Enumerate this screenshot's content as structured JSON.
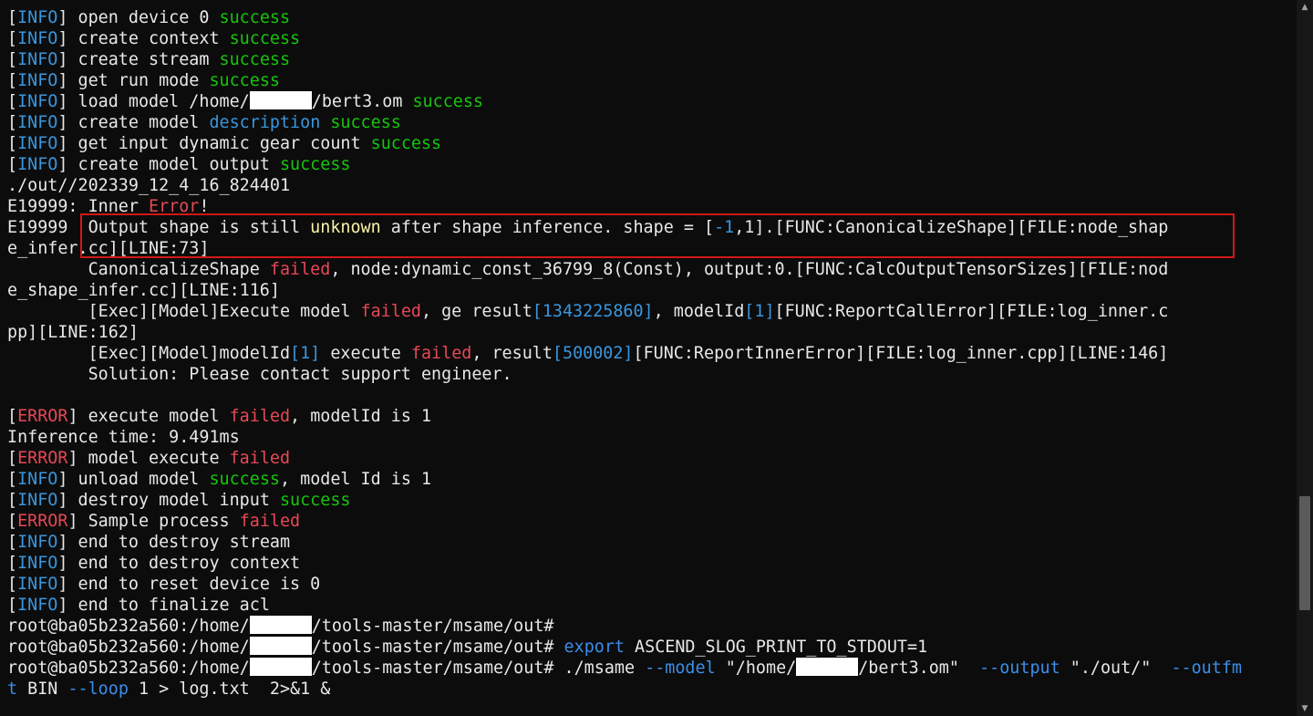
{
  "terminal": {
    "colors": {
      "background": "#0c0c0c",
      "text": "#e8e8e8",
      "info_tag": "#3a96dd",
      "success": "#16c60c",
      "error": "#e74856",
      "highlight_border": "#d01818"
    },
    "lines": [
      [
        {
          "t": "["
        },
        {
          "t": "INFO",
          "c": "info"
        },
        {
          "t": "] open device 0 "
        },
        {
          "t": "success",
          "c": "success"
        }
      ],
      [
        {
          "t": "["
        },
        {
          "t": "INFO",
          "c": "info"
        },
        {
          "t": "] create context "
        },
        {
          "t": "success",
          "c": "success"
        }
      ],
      [
        {
          "t": "["
        },
        {
          "t": "INFO",
          "c": "info"
        },
        {
          "t": "] create stream "
        },
        {
          "t": "success",
          "c": "success"
        }
      ],
      [
        {
          "t": "["
        },
        {
          "t": "INFO",
          "c": "info"
        },
        {
          "t": "] get run mode "
        },
        {
          "t": "success",
          "c": "success"
        }
      ],
      [
        {
          "t": "["
        },
        {
          "t": "INFO",
          "c": "info"
        },
        {
          "t": "] load model /home/"
        },
        {
          "r": true
        },
        {
          "t": "/bert3.om "
        },
        {
          "t": "success",
          "c": "success"
        }
      ],
      [
        {
          "t": "["
        },
        {
          "t": "INFO",
          "c": "info"
        },
        {
          "t": "] create model "
        },
        {
          "t": "description",
          "c": "blue"
        },
        {
          "t": " "
        },
        {
          "t": "success",
          "c": "success"
        }
      ],
      [
        {
          "t": "["
        },
        {
          "t": "INFO",
          "c": "info"
        },
        {
          "t": "] get input dynamic gear count "
        },
        {
          "t": "success",
          "c": "success"
        }
      ],
      [
        {
          "t": "["
        },
        {
          "t": "INFO",
          "c": "info"
        },
        {
          "t": "] create model output "
        },
        {
          "t": "success",
          "c": "success"
        }
      ],
      [
        {
          "t": "./out//202339_12_4_16_824401"
        }
      ],
      [
        {
          "t": "E19999: Inner "
        },
        {
          "t": "Error",
          "c": "error"
        },
        {
          "t": "!"
        }
      ],
      [
        {
          "t": "E19999  Output shape is still "
        },
        {
          "t": "unknown",
          "c": "yellow"
        },
        {
          "t": " after shape inference. shape = ["
        },
        {
          "t": "-1",
          "c": "blue"
        },
        {
          "t": ",1].[FUNC:CanonicalizeShape][FILE:node_shap"
        }
      ],
      [
        {
          "t": "e_infer.cc][LINE:73]"
        }
      ],
      [
        {
          "t": "        CanonicalizeShape "
        },
        {
          "t": "failed",
          "c": "error"
        },
        {
          "t": ", node:dynamic_const_36799_8(Const), output:0.[FUNC:CalcOutputTensorSizes][FILE:nod"
        }
      ],
      [
        {
          "t": "e_shape_infer.cc][LINE:116]"
        }
      ],
      [
        {
          "t": "        [Exec][Model]Execute model "
        },
        {
          "t": "failed",
          "c": "error"
        },
        {
          "t": ", ge result"
        },
        {
          "t": "[1343225860]",
          "c": "blue"
        },
        {
          "t": ", modelId"
        },
        {
          "t": "[1]",
          "c": "blue"
        },
        {
          "t": "[FUNC:ReportCallError][FILE:log_inner.c"
        }
      ],
      [
        {
          "t": "pp][LINE:162]"
        }
      ],
      [
        {
          "t": "        [Exec][Model]modelId"
        },
        {
          "t": "[1]",
          "c": "blue"
        },
        {
          "t": " execute "
        },
        {
          "t": "failed",
          "c": "error"
        },
        {
          "t": ", result"
        },
        {
          "t": "[500002]",
          "c": "blue"
        },
        {
          "t": "[FUNC:ReportInnerError][FILE:log_inner.cpp][LINE:146]"
        }
      ],
      [
        {
          "t": "        Solution: Please contact support engineer."
        }
      ],
      [
        {
          "t": ""
        }
      ],
      [
        {
          "t": "["
        },
        {
          "t": "ERROR",
          "c": "error"
        },
        {
          "t": "] execute model "
        },
        {
          "t": "failed",
          "c": "error"
        },
        {
          "t": ", modelId is 1"
        }
      ],
      [
        {
          "t": "Inference time: 9.491ms"
        }
      ],
      [
        {
          "t": "["
        },
        {
          "t": "ERROR",
          "c": "error"
        },
        {
          "t": "] model execute "
        },
        {
          "t": "failed",
          "c": "error"
        }
      ],
      [
        {
          "t": "["
        },
        {
          "t": "INFO",
          "c": "info"
        },
        {
          "t": "] unload model "
        },
        {
          "t": "success",
          "c": "success"
        },
        {
          "t": ", model Id is 1"
        }
      ],
      [
        {
          "t": "["
        },
        {
          "t": "INFO",
          "c": "info"
        },
        {
          "t": "] destroy model input "
        },
        {
          "t": "success",
          "c": "success"
        }
      ],
      [
        {
          "t": "["
        },
        {
          "t": "ERROR",
          "c": "error"
        },
        {
          "t": "] Sample process "
        },
        {
          "t": "failed",
          "c": "error"
        }
      ],
      [
        {
          "t": "["
        },
        {
          "t": "INFO",
          "c": "info"
        },
        {
          "t": "] end to destroy stream"
        }
      ],
      [
        {
          "t": "["
        },
        {
          "t": "INFO",
          "c": "info"
        },
        {
          "t": "] end to destroy context"
        }
      ],
      [
        {
          "t": "["
        },
        {
          "t": "INFO",
          "c": "info"
        },
        {
          "t": "] end to reset device is 0"
        }
      ],
      [
        {
          "t": "["
        },
        {
          "t": "INFO",
          "c": "info"
        },
        {
          "t": "] end to finalize acl"
        }
      ],
      [
        {
          "t": "root@ba05b232a560:/home/"
        },
        {
          "r": true
        },
        {
          "t": "/tools-master/msame/out#"
        }
      ],
      [
        {
          "t": "root@ba05b232a560:/home/"
        },
        {
          "r": true
        },
        {
          "t": "/tools-master/msame/out# "
        },
        {
          "t": "export",
          "c": "cmd"
        },
        {
          "t": " ASCEND_SLOG_PRINT_TO_STDOUT=1"
        }
      ],
      [
        {
          "t": "root@ba05b232a560:/home/"
        },
        {
          "r": true
        },
        {
          "t": "/tools-master/msame/out# ./msame "
        },
        {
          "t": "--model",
          "c": "cmd"
        },
        {
          "t": " \"/home/"
        },
        {
          "r": true
        },
        {
          "t": "/bert3.om\"  "
        },
        {
          "t": "--output",
          "c": "cmd"
        },
        {
          "t": " \"./out/\"  "
        },
        {
          "t": "--outfm",
          "c": "cmd"
        }
      ],
      [
        {
          "t": "t",
          "c": "cmd"
        },
        {
          "t": " BIN "
        },
        {
          "t": "--loop",
          "c": "cmd"
        },
        {
          "t": " 1 > log.txt  2>&1 &"
        }
      ]
    ]
  },
  "scrollbar": {
    "up_icon": "triangle-up",
    "down_icon": "triangle-down",
    "position_fraction": 0.84
  }
}
